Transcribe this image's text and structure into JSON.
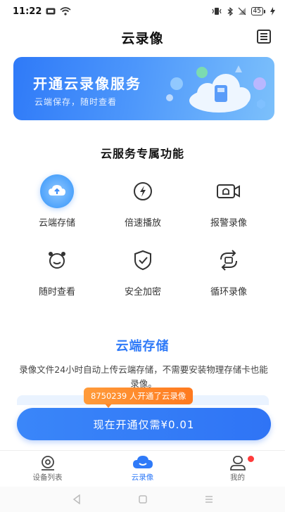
{
  "status": {
    "time": "11:22",
    "battery": "45"
  },
  "header": {
    "title": "云录像"
  },
  "banner": {
    "title": "开通云录像服务",
    "subtitle": "云端保存，随时查看"
  },
  "section": {
    "title": "云服务专属功能"
  },
  "features": [
    {
      "label": "云端存储",
      "icon": "cloud-upload-icon"
    },
    {
      "label": "倍速播放",
      "icon": "speed-bolt-icon"
    },
    {
      "label": "报警录像",
      "icon": "alarm-camera-icon"
    },
    {
      "label": "随时查看",
      "icon": "alarm-clock-icon"
    },
    {
      "label": "安全加密",
      "icon": "shield-check-icon"
    },
    {
      "label": "循环录像",
      "icon": "loop-record-icon"
    }
  ],
  "detail": {
    "title": "云端存储",
    "description": "录像文件24小时自动上传云端存储，不需要安装物理存储卡也能录像。"
  },
  "promo": {
    "tooltip": "8750239 人开通了云录像",
    "cta": "现在开通仅需¥0.01"
  },
  "tabs": [
    {
      "label": "设备列表",
      "icon": "device-list-icon"
    },
    {
      "label": "云录像",
      "icon": "cloud-record-icon",
      "active": true
    },
    {
      "label": "我的",
      "icon": "profile-icon",
      "badge": true
    }
  ],
  "colors": {
    "accent": "#2f7af8",
    "promo": "#ff8a2a",
    "badge": "#ff3b3b"
  }
}
